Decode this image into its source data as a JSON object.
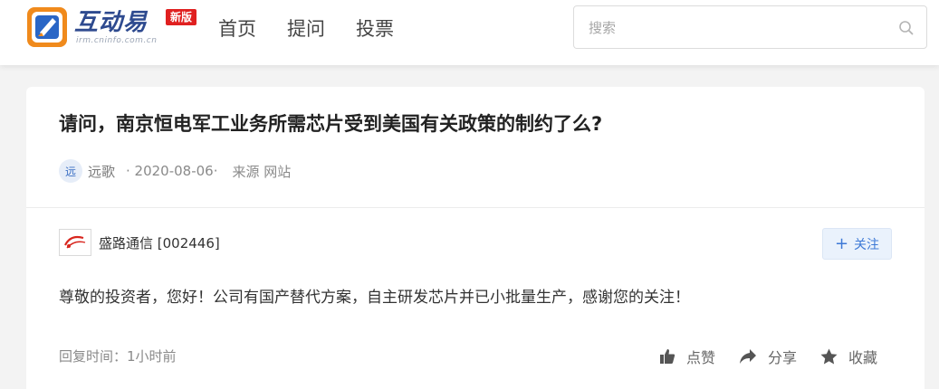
{
  "header": {
    "logo_title": "互动易",
    "logo_badge": "新版",
    "logo_sub": "irm.cninfo.com.cn",
    "nav": [
      "首页",
      "提问",
      "投票"
    ],
    "search_placeholder": "搜索"
  },
  "question": {
    "title": "请问，南京恒电军工业务所需芯片受到美国有关政策的制约了么?",
    "avatar_char": "远",
    "author": "远歌",
    "date": "· 2020-08-06·",
    "source": "来源 网站"
  },
  "answer": {
    "company": "盛路通信 [002446]",
    "follow_label": "关注",
    "follow_symbol": "+",
    "text": "尊敬的投资者，您好！公司有国产替代方案，自主研发芯片并已小批量生产，感谢您的关注！",
    "reply_time": "回复时间：1小时前",
    "like_label": "点赞",
    "share_label": "分享",
    "fav_label": "收藏"
  },
  "colors": {
    "brand_blue": "#2e4a8f",
    "badge_red": "#e02020",
    "follow_blue": "#3d79d6"
  },
  "icons": [
    "logo-icon",
    "search-icon",
    "company-logo-icon",
    "thumbs-up-icon",
    "share-icon",
    "star-icon"
  ]
}
